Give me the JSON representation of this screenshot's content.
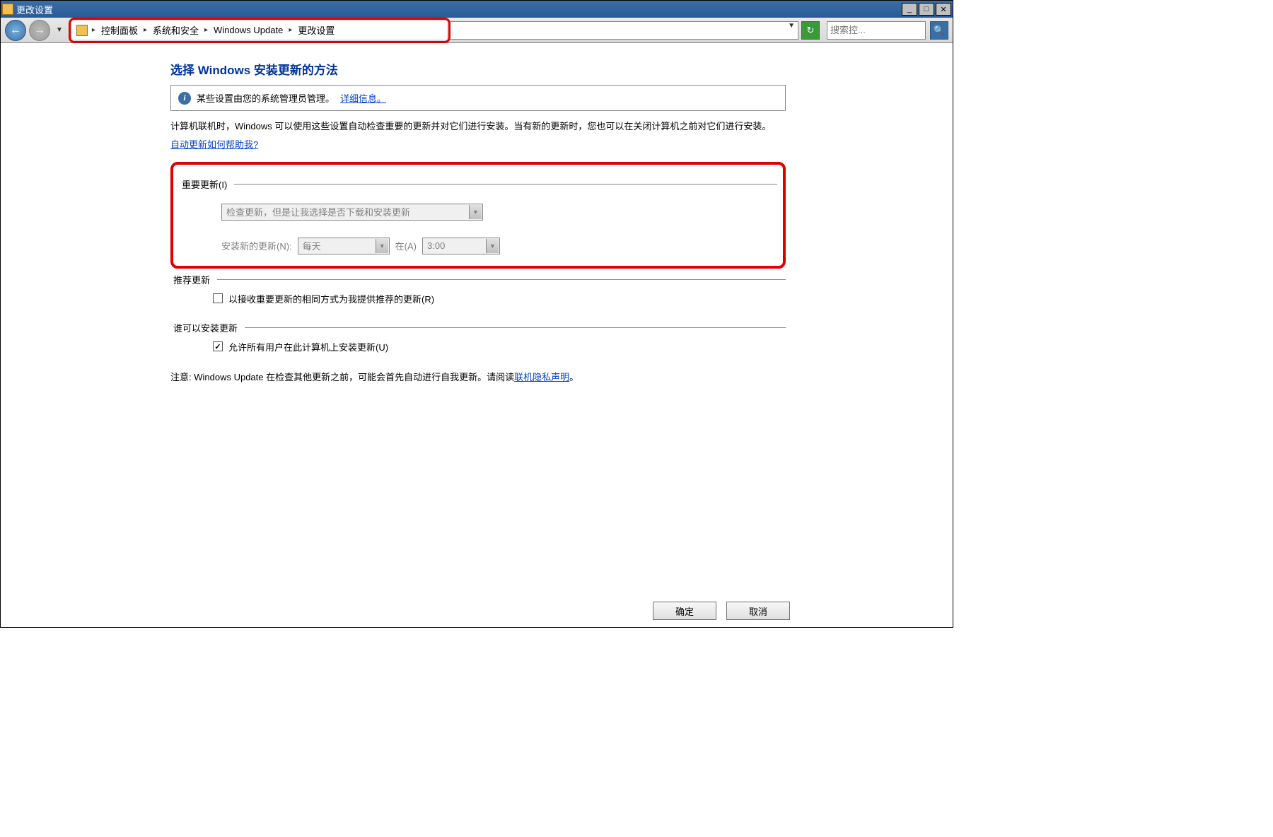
{
  "window": {
    "title": "更改设置"
  },
  "breadcrumb": {
    "items": [
      "控制面板",
      "系统和安全",
      "Windows Update",
      "更改设置"
    ]
  },
  "search": {
    "placeholder": "搜索控..."
  },
  "page": {
    "title": "选择 Windows 安装更新的方法",
    "banner_text": "某些设置由您的系统管理员管理。",
    "banner_link": "详细信息。",
    "desc": "计算机联机时，Windows 可以使用这些设置自动检查重要的更新并对它们进行安装。当有新的更新时，您也可以在关闭计算机之前对它们进行安装。",
    "help_link": "自动更新如何帮助我?"
  },
  "important": {
    "group_label": "重要更新(I)",
    "combo_value": "检查更新，但是让我选择是否下载和安装更新",
    "install_label": "安装新的更新(N):",
    "freq_value": "每天",
    "at_label": "在(A)",
    "time_value": "3:00"
  },
  "recommended": {
    "group_label": "推荐更新",
    "checkbox_label": "以接收重要更新的相同方式为我提供推荐的更新(R)",
    "checked": false
  },
  "who": {
    "group_label": "谁可以安装更新",
    "checkbox_label": "允许所有用户在此计算机上安装更新(U)",
    "checked": true
  },
  "note": {
    "prefix": "注意: Windows Update 在检查其他更新之前，可能会首先自动进行自我更新。请阅读",
    "link": "联机隐私声明",
    "suffix": "。"
  },
  "buttons": {
    "ok": "确定",
    "cancel": "取消"
  }
}
